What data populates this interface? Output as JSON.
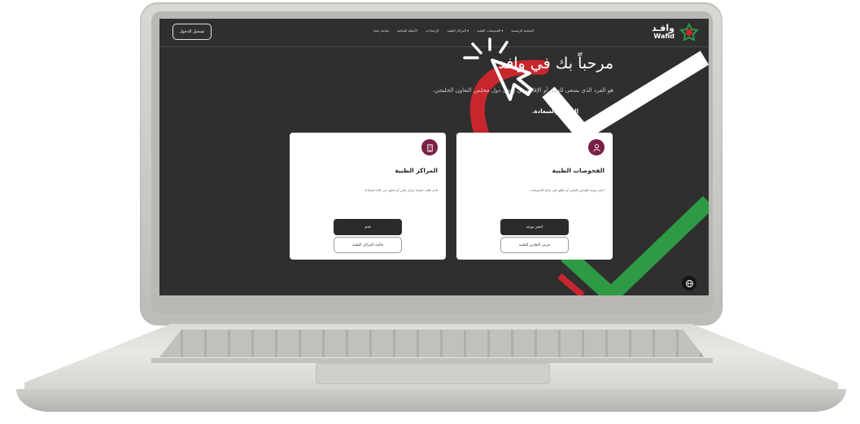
{
  "header": {
    "login_label": "تسجيل الدخول",
    "nav_items": [
      {
        "label": "الصفحة الرئيسية"
      },
      {
        "label": "الفحوصات الطبية ▾"
      },
      {
        "label": "المراكز الطبية ▾"
      },
      {
        "label": "الإرشادات"
      },
      {
        "label": "الأسئلة الشائعة"
      },
      {
        "label": "تواصل معنا"
      }
    ],
    "logo_ar": "وافـد",
    "logo_en": "Wafid"
  },
  "hero": {
    "title": "مرحباً بك في وافد",
    "subtitle": "هو الفرد الذي يسعى للعمل أو الإقامة في إحدى دول مجلس التعاون الخليجي.",
    "tagline": "الصحة والسعادة."
  },
  "cards": [
    {
      "title": "الفحوصات الطبية",
      "description": "احجز موعد للفحص الطبي أو اطلع على نتائج الفحوصات",
      "primary_label": "احجز موعد",
      "secondary_label": "عرض التقارير الطبية"
    },
    {
      "title": "المراكز الطبية",
      "description": "قدم طلب اعتماد مركز طبي أو تحقق من حالة اعتمادك",
      "primary_label": "قدم",
      "secondary_label": "قائمة المراكز الطبية"
    }
  ],
  "colors": {
    "screen_bg": "#2f2f2f",
    "brand_maroon": "#7a1f45",
    "accent_red": "#c8262c",
    "accent_green": "#2e9a45",
    "button_dark": "#2b2b2b"
  },
  "icons": {
    "card1": "user-icon",
    "card2": "building-icon",
    "lang": "globe-icon",
    "pointer": "cursor-icon"
  }
}
